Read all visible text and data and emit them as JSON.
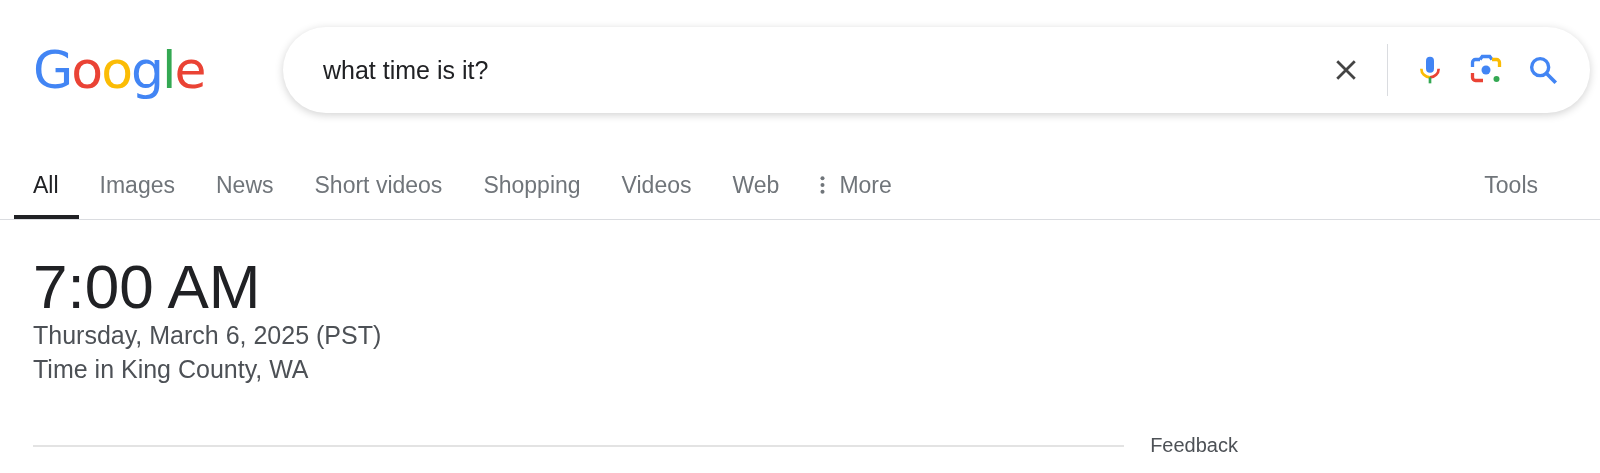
{
  "logo": "Google",
  "search": {
    "value": "what time is it?"
  },
  "tabs": [
    {
      "label": "All",
      "selected": true
    },
    {
      "label": "Images",
      "selected": false
    },
    {
      "label": "News",
      "selected": false
    },
    {
      "label": "Short videos",
      "selected": false
    },
    {
      "label": "Shopping",
      "selected": false
    },
    {
      "label": "Videos",
      "selected": false
    },
    {
      "label": "Web",
      "selected": false
    },
    {
      "label": "More",
      "selected": false,
      "kind": "menu"
    }
  ],
  "tools": "Tools",
  "result": {
    "time": "7:00 AM",
    "date": "Thursday, March 6, 2025 (PST)",
    "location": "Time in King County, WA"
  },
  "feedback": "Feedback"
}
